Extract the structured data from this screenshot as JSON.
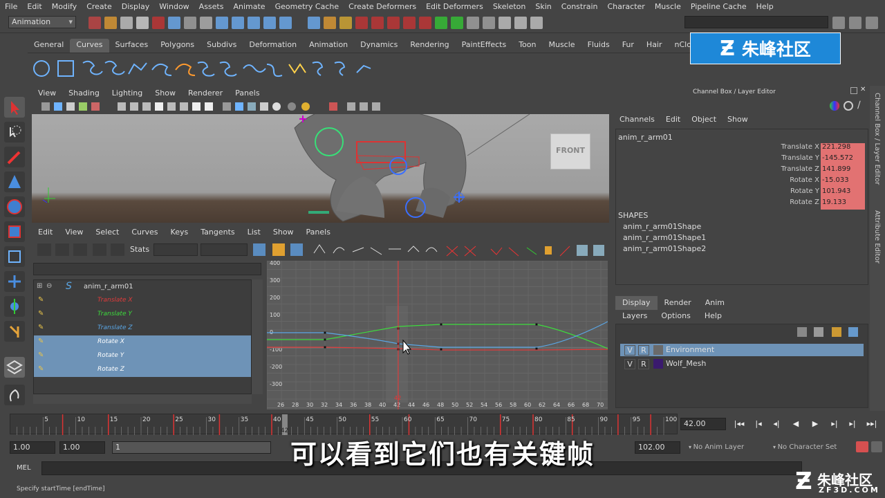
{
  "menubar": [
    "File",
    "Edit",
    "Modify",
    "Create",
    "Display",
    "Window",
    "Assets",
    "Animate",
    "Geometry Cache",
    "Create Deformers",
    "Edit Deformers",
    "Skeleton",
    "Skin",
    "Constrain",
    "Character",
    "Muscle",
    "Pipeline Cache",
    "Help"
  ],
  "mode_menu": "Animation",
  "shelf_tabs": [
    "General",
    "Curves",
    "Surfaces",
    "Polygons",
    "Subdivs",
    "Deformation",
    "Animation",
    "Dynamics",
    "Rendering",
    "PaintEffects",
    "Toon",
    "Muscle",
    "Fluids",
    "Fur",
    "Hair",
    "nClo"
  ],
  "shelf_active": "Curves",
  "logo_text": "朱峰社区",
  "viewport_menu": [
    "View",
    "Shading",
    "Lighting",
    "Show",
    "Renderer",
    "Panels"
  ],
  "viewcube_label": "FRONT",
  "graph_menu": [
    "Edit",
    "View",
    "Select",
    "Curves",
    "Keys",
    "Tangents",
    "List",
    "Show",
    "Panels"
  ],
  "graph_stats_label": "Stats",
  "outliner": {
    "root": "anim_r_arm01",
    "channels": [
      {
        "label": "Translate X",
        "color": "#e23b3b",
        "selected": false
      },
      {
        "label": "Translate Y",
        "color": "#3ddc3d",
        "selected": false
      },
      {
        "label": "Translate Z",
        "color": "#5aa7e6",
        "selected": false
      },
      {
        "label": "Rotate X",
        "color": "#ffffff",
        "selected": true
      },
      {
        "label": "Rotate Y",
        "color": "#ffffff",
        "selected": true
      },
      {
        "label": "Rotate Z",
        "color": "#ffffff",
        "selected": true
      }
    ]
  },
  "graph": {
    "y_ticks": [
      "400",
      "300",
      "200",
      "100",
      "0",
      "-100",
      "-200",
      "-300"
    ],
    "x_ticks": [
      "26",
      "28",
      "30",
      "32",
      "34",
      "36",
      "38",
      "40",
      "42",
      "44",
      "46",
      "48",
      "50",
      "52",
      "54",
      "56",
      "58",
      "60",
      "62",
      "64",
      "66",
      "68",
      "70"
    ],
    "current_frame_label": "42"
  },
  "timeline": {
    "ticks": [
      "5",
      "10",
      "15",
      "20",
      "25",
      "30",
      "35",
      "40",
      "45",
      "50",
      "55",
      "60",
      "65",
      "70",
      "75",
      "80",
      "85",
      "90",
      "95",
      "100"
    ],
    "current_time": "42.00",
    "current_marker": "42"
  },
  "range": {
    "start_time": "1.00",
    "start_range": "1.00",
    "range_field": "1",
    "end_range": "102.00",
    "anim_layer": "No Anim Layer",
    "character_set": "No Character Set"
  },
  "mel_label": "MEL",
  "help_line": "Specify startTime [endTime]",
  "channel_box": {
    "title": "Channel Box / Layer Editor",
    "menu": [
      "Channels",
      "Edit",
      "Object",
      "Show"
    ],
    "object": "anim_r_arm01",
    "attributes": [
      {
        "name": "Translate X",
        "value": "221.298"
      },
      {
        "name": "Translate Y",
        "value": "-145.572"
      },
      {
        "name": "Translate Z",
        "value": "141.899"
      },
      {
        "name": "Rotate X",
        "value": "-15.033"
      },
      {
        "name": "Rotate Y",
        "value": "101.943"
      },
      {
        "name": "Rotate Z",
        "value": "19.133"
      }
    ],
    "shapes_label": "SHAPES",
    "shapes": [
      "anim_r_arm01Shape",
      "anim_r_arm01Shape1",
      "anim_r_arm01Shape2"
    ]
  },
  "layer_editor": {
    "tabs": [
      "Display",
      "Render",
      "Anim"
    ],
    "active_tab": "Display",
    "menu": [
      "Layers",
      "Options",
      "Help"
    ],
    "layers": [
      {
        "v": "V",
        "r": "R",
        "name": "Environment",
        "color": "#6a6a6a",
        "selected": true
      },
      {
        "v": "V",
        "r": "R",
        "name": "Wolf_Mesh",
        "color": "#3a1a6e",
        "selected": false
      }
    ]
  },
  "side_tabs": [
    "Channel Box / Layer Editor",
    "Attribute Editor"
  ],
  "subtitle": "可以看到它们也有关键帧",
  "watermark": {
    "text": "朱峰社区",
    "url": "ZF3D.COM"
  }
}
